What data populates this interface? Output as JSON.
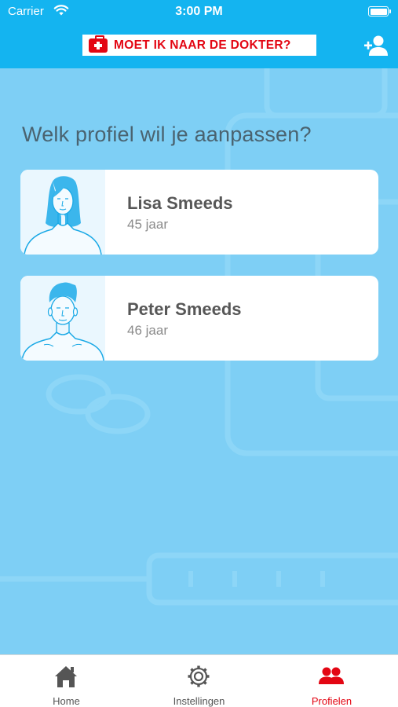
{
  "status_bar": {
    "carrier": "Carrier",
    "time": "3:00 PM"
  },
  "header": {
    "logo_text": "MOET IK NAAR DE DOKTER?"
  },
  "main": {
    "heading": "Welk profiel wil je aanpassen?",
    "profiles": [
      {
        "name": "Lisa Smeeds",
        "age": "45 jaar"
      },
      {
        "name": "Peter Smeeds",
        "age": "46 jaar"
      }
    ]
  },
  "tabs": [
    {
      "label": "Home",
      "icon": "home-icon",
      "active": false
    },
    {
      "label": "Instellingen",
      "icon": "gear-icon",
      "active": false
    },
    {
      "label": "Profielen",
      "icon": "users-icon",
      "active": true
    }
  ],
  "colors": {
    "header": "#14b4f0",
    "background": "#7ecff5",
    "brand_red": "#e30613",
    "avatar_line": "#1aa9e6"
  }
}
